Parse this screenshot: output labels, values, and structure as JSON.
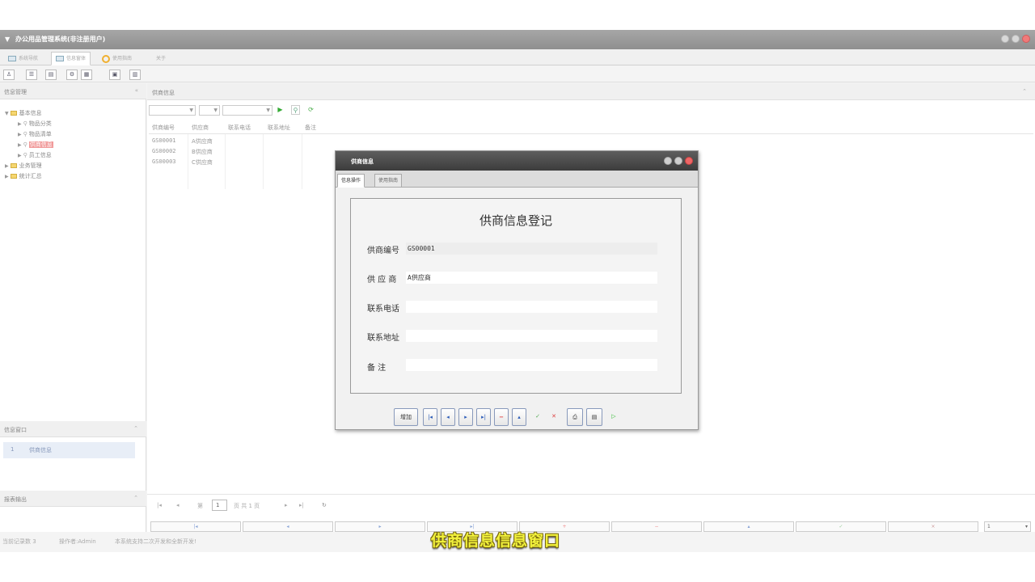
{
  "window": {
    "title": "办公用品管理系统(非注册用户)"
  },
  "menu_tabs": [
    {
      "label": "系统导航"
    },
    {
      "label": "信息窗体"
    },
    {
      "label": "使用指南"
    },
    {
      "label": "关于"
    }
  ],
  "left_panel": {
    "header": "信息管理",
    "collapse_icon": "«",
    "tree": {
      "root1": "基本信息",
      "children": [
        "物品分类",
        "物品清单",
        "供商信息",
        "员工信息"
      ],
      "root2": "业务管理",
      "root3": "统计汇总"
    },
    "info_window": {
      "header": "信息窗口",
      "item_no": "1",
      "item_label": "供商信息"
    },
    "report": {
      "header": "报表输出"
    }
  },
  "main_panel": {
    "header": "供商信息",
    "columns": [
      "供商编号",
      "供应商",
      "联系电话",
      "联系地址",
      "备注"
    ],
    "rows": [
      [
        "GS00001",
        "A供应商"
      ],
      [
        "GS00002",
        "B供应商"
      ],
      [
        "GS00003",
        "C供应商"
      ]
    ],
    "pager": {
      "page_prefix": "第",
      "page_value": "1",
      "page_suffix": "页 共 1 页"
    },
    "bottom_page_select": "1"
  },
  "status_bar": {
    "records": "当前记录数 3",
    "operator": "操作者:Admin",
    "note": "本系统支持二次开发和全新开发!"
  },
  "dialog": {
    "title": "供商信息",
    "tabs": [
      "信息操作",
      "使用指南"
    ],
    "form_title": "供商信息登记",
    "fields": [
      {
        "label": "供商编号",
        "value": "GS00001"
      },
      {
        "label": "供 应 商",
        "value": "A供应商"
      },
      {
        "label": "联系电话",
        "value": ""
      },
      {
        "label": "联系地址",
        "value": ""
      },
      {
        "label": "备 注",
        "value": ""
      }
    ],
    "buttons": {
      "add": "增加"
    }
  },
  "subtitle": "供商信息信息窗口",
  "colors": {
    "titlebar": "#9a9a9a",
    "dialog_titlebar": "#4a4a4a",
    "tree_selected": "#f19a9a",
    "info_window_bg": "#e8eef7",
    "subtitle": "#f2f23c"
  }
}
